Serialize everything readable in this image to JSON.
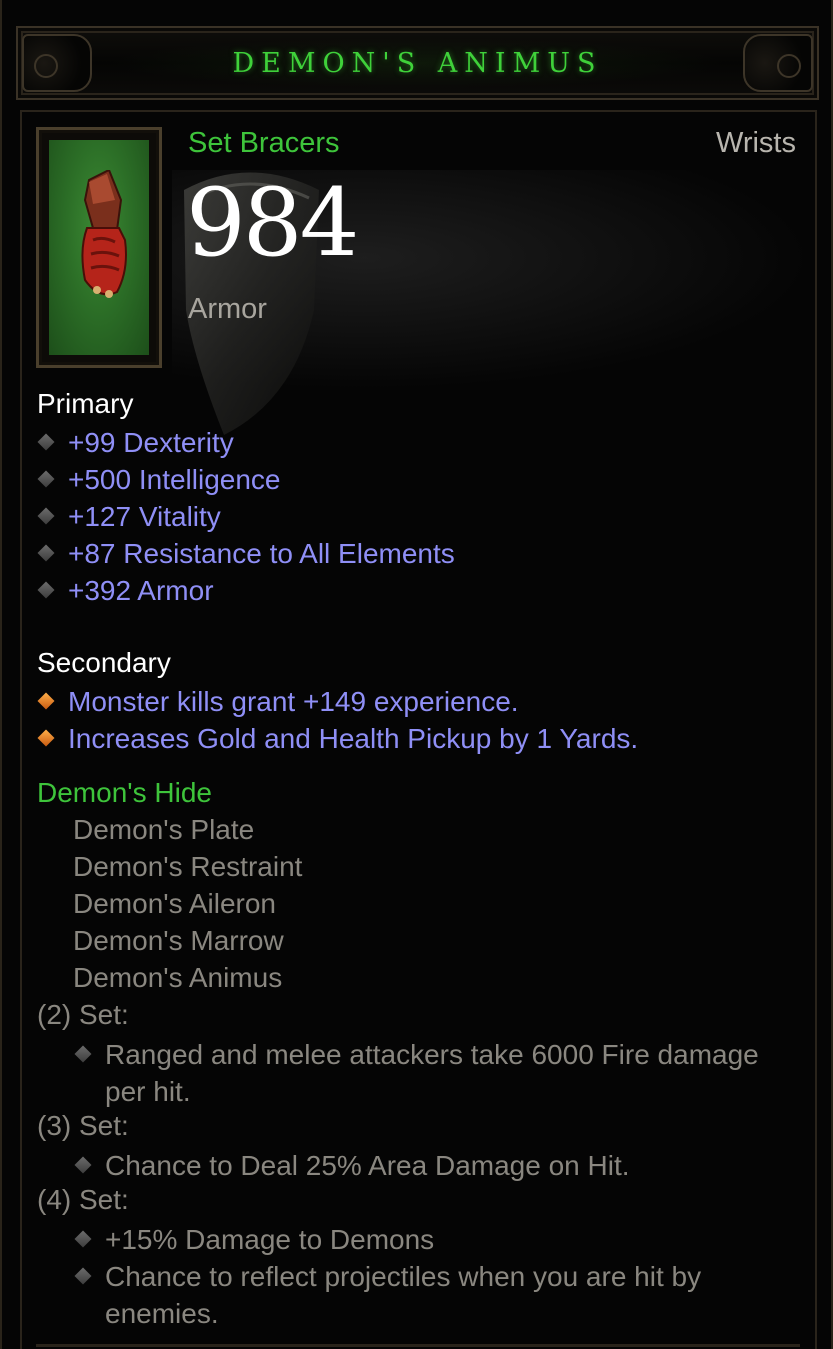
{
  "item": {
    "name": "DEMON'S ANIMUS",
    "type": "Set Bracers",
    "slot": "Wrists",
    "armor_value": "984",
    "armor_label": "Armor",
    "icon": "bracer-icon"
  },
  "primary": {
    "label": "Primary",
    "stats": [
      "+99 Dexterity",
      "+500 Intelligence",
      "+127 Vitality",
      "+87 Resistance to All Elements",
      "+392 Armor"
    ]
  },
  "secondary": {
    "label": "Secondary",
    "stats": [
      "Monster kills grant +149 experience.",
      "Increases Gold and Health Pickup by 1 Yards."
    ]
  },
  "set": {
    "name": "Demon's Hide",
    "pieces": [
      "Demon's Plate",
      "Demon's Restraint",
      "Demon's Aileron",
      "Demon's Marrow",
      "Demon's Animus"
    ],
    "bonuses": [
      {
        "tier": "(2) Set:",
        "effects": [
          "Ranged and melee attackers take 6000 Fire damage per hit."
        ]
      },
      {
        "tier": "(3) Set:",
        "effects": [
          "Chance to Deal 25% Area Damage on Hit."
        ]
      },
      {
        "tier": "(4) Set:",
        "effects": [
          "+15% Damage to Demons",
          "Chance to reflect projectiles when you are hit by enemies."
        ]
      }
    ]
  },
  "colors": {
    "set_green": "#3ec43b",
    "magic_blue": "#8f8ff6",
    "inactive_grey": "#8a8780",
    "white": "#ffffff"
  }
}
